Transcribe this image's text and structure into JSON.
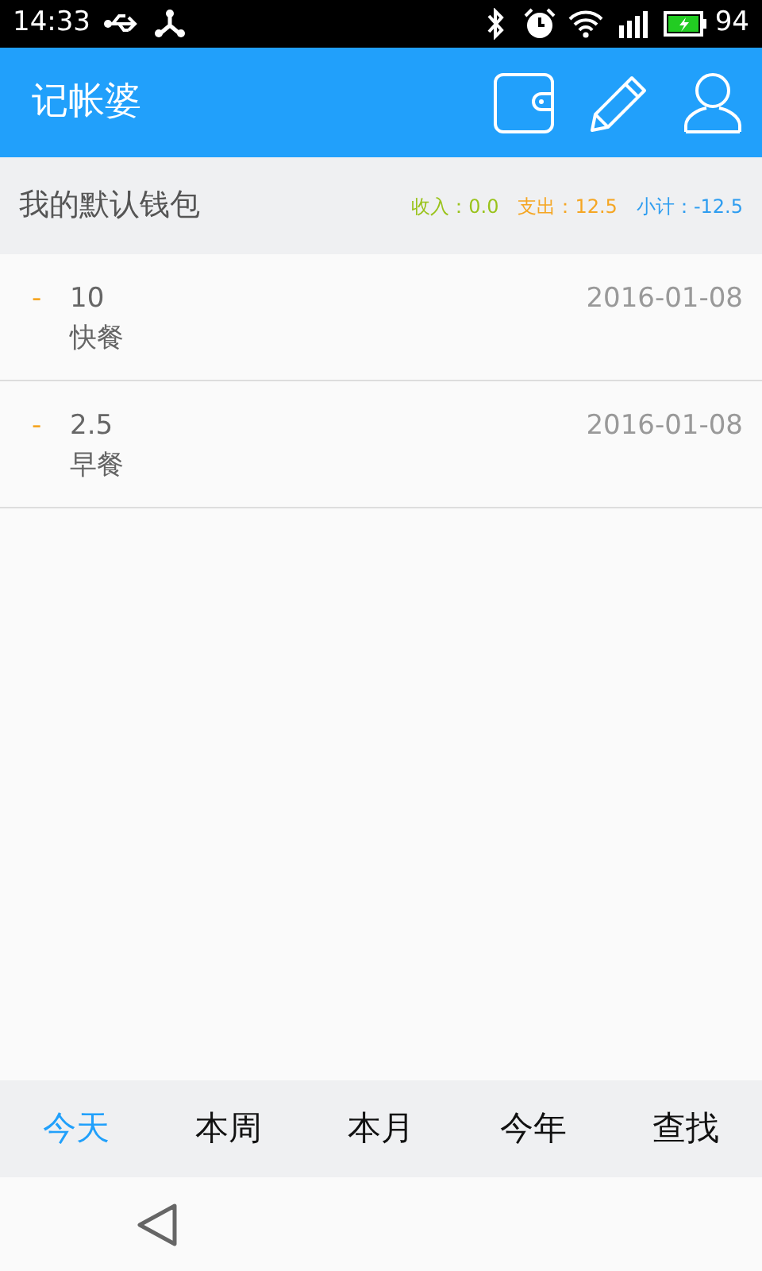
{
  "status_bar": {
    "time": "14:33",
    "battery": "94"
  },
  "app_bar": {
    "title": "记帐婆"
  },
  "wallet": {
    "name": "我的默认钱包",
    "summary": [
      {
        "label": "收入：",
        "value": "0.0",
        "color": "#9ac31c"
      },
      {
        "label": "支出：",
        "value": "12.5",
        "color": "#f5a623"
      },
      {
        "label": "小计：",
        "value": "-12.5",
        "color": "#2e9df0"
      }
    ]
  },
  "entries": [
    {
      "sign": "-",
      "amount": "10",
      "note": "快餐",
      "date": "2016-01-08"
    },
    {
      "sign": "-",
      "amount": "2.5",
      "note": "早餐",
      "date": "2016-01-08"
    }
  ],
  "tabs": [
    {
      "label": "今天",
      "selected": true
    },
    {
      "label": "本周",
      "selected": false
    },
    {
      "label": "本月",
      "selected": false
    },
    {
      "label": "今年",
      "selected": false
    },
    {
      "label": "查找",
      "selected": false
    }
  ]
}
